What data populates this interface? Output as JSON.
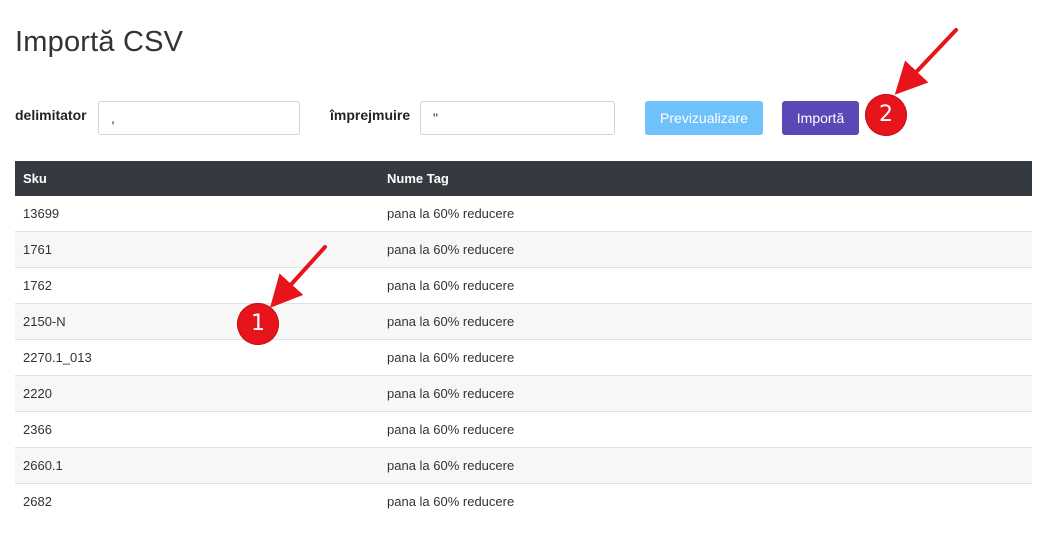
{
  "page": {
    "title": "Importă CSV"
  },
  "form": {
    "delimiter_label": "delimitator",
    "delimiter_value": ",",
    "enclosure_label": "împrejmuire",
    "enclosure_value": "\"",
    "preview_label": "Previzualizare",
    "import_label": "Importă"
  },
  "table": {
    "headers": [
      "Sku",
      "Nume Tag"
    ],
    "rows": [
      [
        "13699",
        "pana la 60% reducere"
      ],
      [
        "1761",
        "pana la 60% reducere"
      ],
      [
        "1762",
        "pana la 60% reducere"
      ],
      [
        "2150-N",
        "pana la 60% reducere"
      ],
      [
        "2270.1_013",
        "pana la 60% reducere"
      ],
      [
        "2220",
        "pana la 60% reducere"
      ],
      [
        "2366",
        "pana la 60% reducere"
      ],
      [
        "2660.1",
        "pana la 60% reducere"
      ],
      [
        "2682",
        "pana la 60% reducere"
      ]
    ]
  },
  "annotations": {
    "badge_1": "1",
    "badge_2": "2"
  },
  "colors": {
    "preview_button": "#6ec1fb",
    "import_button": "#5b47b6",
    "table_header": "#343a40",
    "annotation": "#e8141b"
  }
}
